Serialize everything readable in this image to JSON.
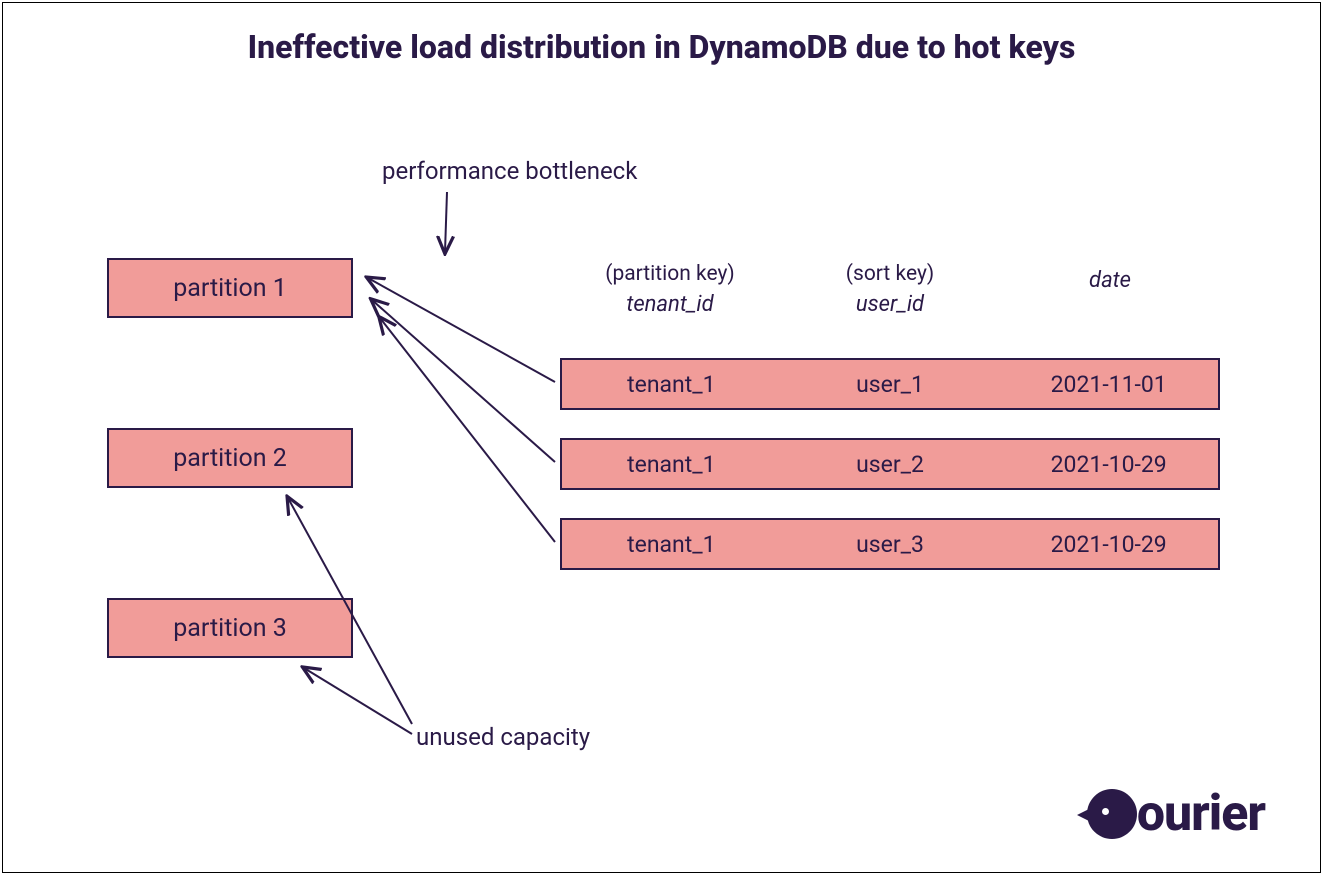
{
  "title": "Ineffective load distribution in DynamoDB due to hot keys",
  "annotations": {
    "bottleneck": "performance bottleneck",
    "unused": "unused capacity"
  },
  "partitions": [
    {
      "label": "partition 1"
    },
    {
      "label": "partition 2"
    },
    {
      "label": "partition 3"
    }
  ],
  "table": {
    "headers": {
      "col1_paren": "(partition key)",
      "col1_name": "tenant_id",
      "col2_paren": "(sort key)",
      "col2_name": "user_id",
      "col3_paren": "",
      "col3_name": "date"
    },
    "rows": [
      {
        "tenant": "tenant_1",
        "user": "user_1",
        "date": "2021-11-01"
      },
      {
        "tenant": "tenant_1",
        "user": "user_2",
        "date": "2021-10-29"
      },
      {
        "tenant": "tenant_1",
        "user": "user_3",
        "date": "2021-10-29"
      }
    ]
  },
  "brand": "ourier"
}
